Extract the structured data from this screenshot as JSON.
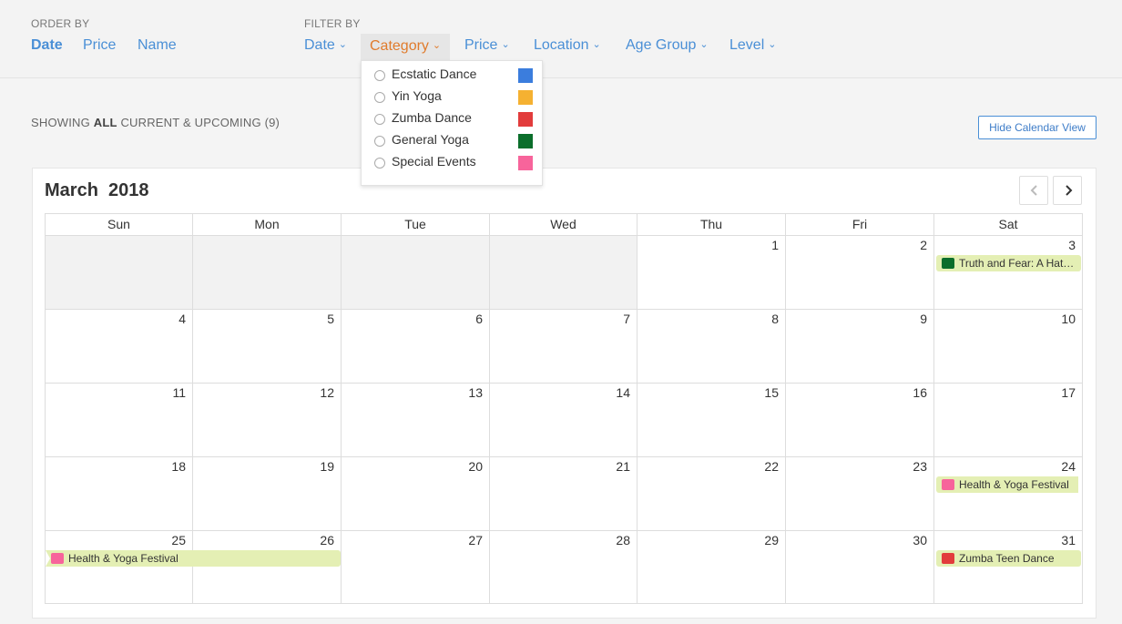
{
  "order_by": {
    "label": "ORDER BY",
    "options": [
      "Date",
      "Price",
      "Name"
    ]
  },
  "filter_by": {
    "label": "FILTER BY",
    "options": [
      "Date",
      "Category",
      "Price",
      "Location",
      "Age Group",
      "Level"
    ],
    "active": "Category"
  },
  "category_dropdown": {
    "items": [
      {
        "label": "Ecstatic Dance",
        "color": "#3b7ddd"
      },
      {
        "label": "Yin Yoga",
        "color": "#f5b131"
      },
      {
        "label": "Zumba Dance",
        "color": "#e23c3c"
      },
      {
        "label": "General Yoga",
        "color": "#0b6e2b"
      },
      {
        "label": "Special Events",
        "color": "#f7649b"
      }
    ]
  },
  "showing": {
    "prefix": "SHOWING",
    "emphasis": "ALL",
    "suffix": "CURRENT & UPCOMING (9)"
  },
  "hide_calendar_button": "Hide Calendar View",
  "calendar": {
    "title": "March  2018",
    "prev_icon": "chevron-left-icon",
    "next_icon": "chevron-right-icon",
    "weekdays": [
      "Sun",
      "Mon",
      "Tue",
      "Wed",
      "Thu",
      "Fri",
      "Sat"
    ],
    "weeks": [
      [
        "",
        "",
        "",
        "",
        "1",
        "2",
        "3"
      ],
      [
        "4",
        "5",
        "6",
        "7",
        "8",
        "9",
        "10"
      ],
      [
        "11",
        "12",
        "13",
        "14",
        "15",
        "16",
        "17"
      ],
      [
        "18",
        "19",
        "20",
        "21",
        "22",
        "23",
        "24"
      ],
      [
        "25",
        "26",
        "27",
        "28",
        "29",
        "30",
        "31"
      ]
    ],
    "events": [
      {
        "title": "Truth and Fear: A Hath…",
        "color": "#0b6e2b"
      },
      {
        "title": "Health & Yoga Festival",
        "color": "#f7649b"
      },
      {
        "title": "Health & Yoga Festival",
        "color": "#f7649b"
      },
      {
        "title": "Zumba Teen Dance",
        "color": "#e23c3c"
      }
    ]
  }
}
